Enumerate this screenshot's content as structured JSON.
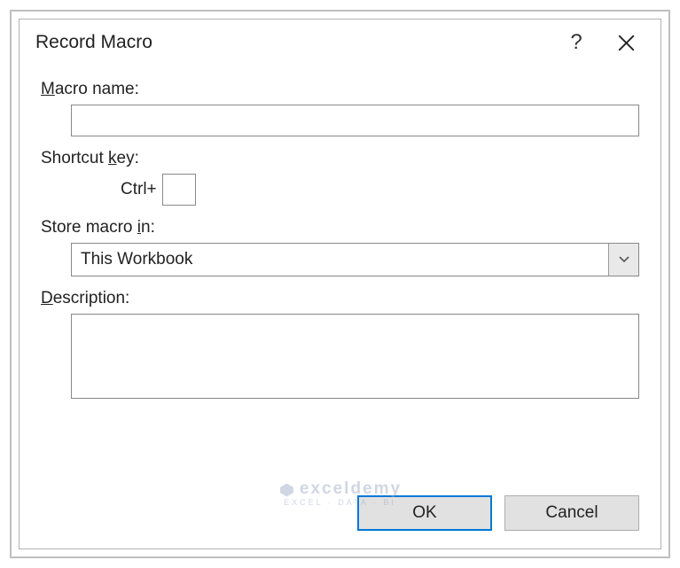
{
  "dialog": {
    "title": "Record Macro",
    "labels": {
      "macroName": "acro name:",
      "macroName_ak": "M",
      "shortcutKey": "ey:",
      "shortcutKey_prefix": "Shortcut ",
      "shortcutKey_ak": "k",
      "storeIn": "n:",
      "storeIn_prefix": "Store macro ",
      "storeIn_ak": "i",
      "description": "escription:",
      "description_ak": "D"
    },
    "fields": {
      "macroName": "",
      "shortcutPrefix": "Ctrl+",
      "shortcutKey": "",
      "storeIn": "This Workbook",
      "description": ""
    },
    "buttons": {
      "ok": "OK",
      "cancel": "Cancel"
    }
  },
  "watermark": {
    "brand": "exceldemy",
    "tagline": "EXCEL · DATA · BI"
  }
}
